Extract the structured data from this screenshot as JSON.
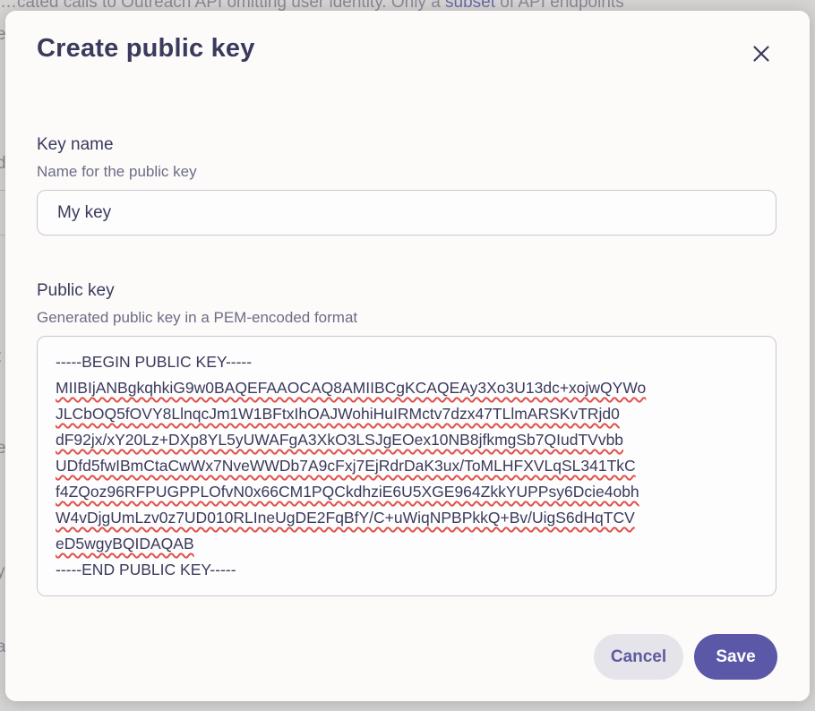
{
  "background": {
    "top_text_before": "…cated calls to Outreach API omitting user identity. Only a ",
    "top_text_link": "subset",
    "top_text_after": " of API endpoints",
    "fragments": [
      "e",
      "l",
      "d",
      "t",
      "e",
      "y",
      "a"
    ]
  },
  "dialog": {
    "title": "Create public key",
    "close_icon": "close-icon"
  },
  "key_name": {
    "label": "Key name",
    "description": "Name for the public key",
    "value": "My key"
  },
  "public_key": {
    "label": "Public key",
    "description": "Generated public key in a PEM-encoded format",
    "lines": [
      "-----BEGIN PUBLIC KEY-----",
      "MIIBIjANBgkqhkiG9w0BAQEFAAOCAQ8AMIIBCgKCAQEAy3Xo3U13dc+xojwQYWo",
      "JLCbOQ5fOVY8LlnqcJm1W1BFtxIhOAJWohiHuIRMctv7dzx47TLlmARSKvTRjd0",
      "dF92jx/xY20Lz+DXp8YL5yUWAFgA3XkO3LSJgEOex10NB8jfkmgSb7QIudTVvbb",
      "UDfd5fwIBmCtaCwWx7NveWWDb7A9cFxj7EjRdrDaK3ux/ToMLHFXVLqSL341TkC",
      "f4ZQoz96RFPUGPPLOfvN0x66CM1PQCkdhziE6U5XGE964ZkkYUPPsy6Dcie4obh",
      "W4vDjgUmLzv0z7UD010RLIneUgDE2FqBfY/C+uWiqNPBPkkQ+Bv/UigS6dHqTCV",
      "eD5wgyBQIDAQAB",
      "-----END PUBLIC KEY-----"
    ]
  },
  "actions": {
    "cancel_label": "Cancel",
    "save_label": "Save"
  },
  "colors": {
    "title": "#3b3a5c",
    "accent": "#5b58a8",
    "spellcheck": "#e0524c"
  }
}
